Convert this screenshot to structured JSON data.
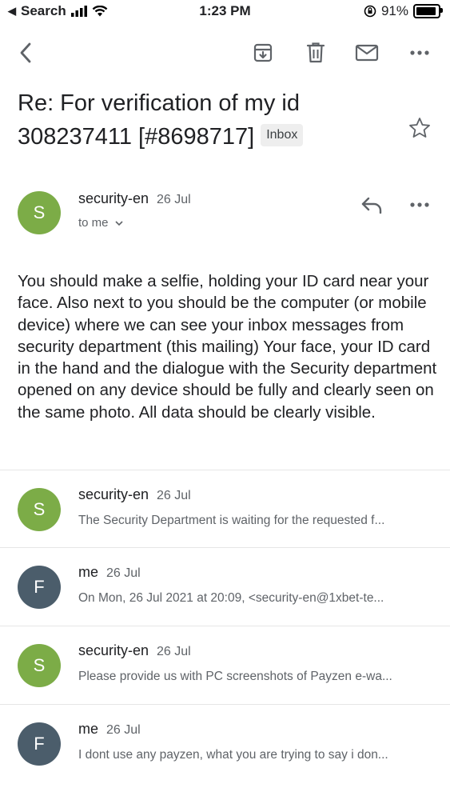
{
  "status": {
    "back_app": "Search",
    "time": "1:23 PM",
    "battery": "91%",
    "battery_level": 0.91
  },
  "toolbar": {
    "back_icon": "chevron-left-icon",
    "archive_icon": "archive-icon",
    "delete_icon": "trash-icon",
    "mark_unread_icon": "mail-icon",
    "more_icon": "more-horizontal-icon"
  },
  "email": {
    "subject": "Re: For verification of my id\n308237411 [#8698717]",
    "label": "Inbox",
    "sender": "security-en",
    "sender_initial": "S",
    "date": "26 Jul",
    "recipient": "to me",
    "body": "You should make a selfie, holding your ID card near your face. Also next to you should be the computer (or mobile device) where we can see your inbox messages from security department (this mailing) Your face, your ID card in the hand and the dialogue with the Security department opened on any device should be fully and clearly seen on the same photo. All data should be clearly visible."
  },
  "thread": [
    {
      "sender": "security-en",
      "initial": "S",
      "date": "26 Jul",
      "snippet": "The Security Department is waiting for the requested f...",
      "avatar_color": "#7cac47"
    },
    {
      "sender": "me",
      "initial": "F",
      "date": "26 Jul",
      "snippet": "On Mon, 26 Jul 2021 at 20:09, <security-en@1xbet-te...",
      "avatar_color": "#4b5d6b"
    },
    {
      "sender": "security-en",
      "initial": "S",
      "date": "26 Jul",
      "snippet": "Please provide us with PC screenshots of Payzen e-wa...",
      "avatar_color": "#7cac47"
    },
    {
      "sender": "me",
      "initial": "F",
      "date": "26 Jul",
      "snippet": "I dont use any payzen, what you are trying to say i don...",
      "avatar_color": "#4b5d6b"
    }
  ],
  "colors": {
    "sender_avatar": "#7cac47",
    "me_avatar": "#4b5d6b",
    "icon_gray": "#5f6368"
  }
}
